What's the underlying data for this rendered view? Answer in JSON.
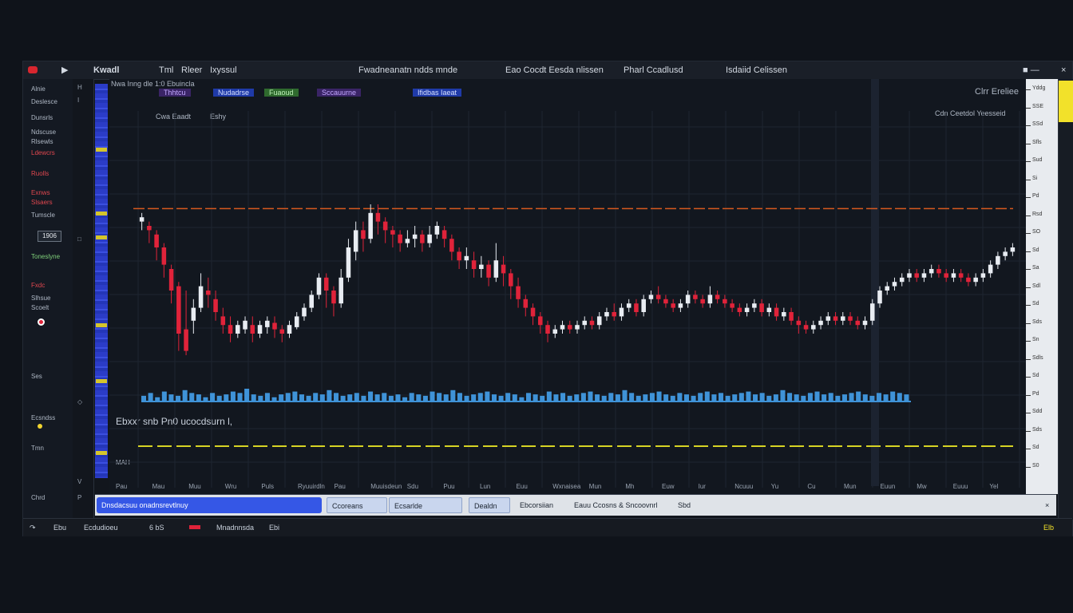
{
  "titlebar": {
    "app_name": "Kwadl",
    "menu": [
      "Tml",
      "Rleer",
      "Ixyssul"
    ],
    "center_text": "Fwadneanatn ndds mnde",
    "title": "Eao Cocdt Eesda nlissen",
    "panel_a": "Pharl Ccadlusd",
    "panel_b": "Isdaiid Celissen"
  },
  "chart_header": {
    "row1_text": "Nwa Inng dle 1:0 Ebuincla",
    "row2_pills": [
      "Thhtcu",
      "Nudadrse",
      "Fuaoud",
      "Sccauurne",
      "Ifidbas Iaeat"
    ],
    "symbol_line": "Cwa Eaadt",
    "symbol_value": "Eshy",
    "right_title": "Clrr Ereliee",
    "right_sub": "Cdn Ceetdol Yeesseid"
  },
  "left_panel": {
    "items": [
      "Alnie",
      "Deslesce",
      "Dunsrls",
      "Ndscuse",
      "Rlsewls",
      "Ldewcrs",
      "Ruolls",
      "Exnws",
      "Slsaers",
      "Tumscle",
      "Toneslyne"
    ],
    "value_box": "1906",
    "lower_items": [
      "Fxdc",
      "Slhsue",
      "Scoelt",
      "Ses",
      "Ecsndss",
      "Tmn"
    ],
    "status_bottom": "Chrd"
  },
  "tools": [
    "H",
    "I",
    "□",
    "◇",
    "V",
    "P"
  ],
  "indicator_label": "Ebxxr snb Pn0 ucocdsurn l,",
  "mini_label": "MAH",
  "chart_data": {
    "type": "candlestick",
    "title": "",
    "xlabel": "",
    "ylabel": "",
    "ylim": [
      0,
      100
    ],
    "reference_line": 88,
    "candles": [
      [
        82,
        84,
        86,
        78
      ],
      [
        80,
        78,
        82,
        72
      ],
      [
        76,
        70,
        78,
        64
      ],
      [
        70,
        62,
        72,
        56
      ],
      [
        60,
        50,
        62,
        44
      ],
      [
        52,
        30,
        54,
        22
      ],
      [
        32,
        22,
        50,
        20
      ],
      [
        36,
        42,
        46,
        30
      ],
      [
        42,
        52,
        58,
        40
      ],
      [
        50,
        48,
        56,
        42
      ],
      [
        46,
        40,
        50,
        36
      ],
      [
        38,
        34,
        42,
        30
      ],
      [
        34,
        30,
        38,
        26
      ],
      [
        30,
        34,
        36,
        28
      ],
      [
        32,
        36,
        38,
        30
      ],
      [
        34,
        30,
        38,
        26
      ],
      [
        30,
        34,
        36,
        28
      ],
      [
        33,
        36,
        38,
        30
      ],
      [
        35,
        32,
        38,
        28
      ],
      [
        32,
        30,
        34,
        26
      ],
      [
        30,
        34,
        36,
        28
      ],
      [
        33,
        38,
        40,
        32
      ],
      [
        38,
        42,
        44,
        36
      ],
      [
        42,
        48,
        50,
        40
      ],
      [
        48,
        56,
        58,
        46
      ],
      [
        56,
        50,
        58,
        42
      ],
      [
        50,
        44,
        52,
        38
      ],
      [
        44,
        56,
        60,
        42
      ],
      [
        56,
        70,
        74,
        54
      ],
      [
        68,
        78,
        82,
        64
      ],
      [
        78,
        74,
        82,
        68
      ],
      [
        74,
        86,
        90,
        72
      ],
      [
        86,
        82,
        90,
        76
      ],
      [
        82,
        78,
        84,
        72
      ],
      [
        78,
        76,
        80,
        70
      ],
      [
        76,
        72,
        78,
        68
      ],
      [
        72,
        74,
        78,
        70
      ],
      [
        74,
        76,
        80,
        70
      ],
      [
        76,
        72,
        78,
        68
      ],
      [
        72,
        76,
        80,
        70
      ],
      [
        76,
        80,
        82,
        74
      ],
      [
        78,
        74,
        80,
        70
      ],
      [
        74,
        68,
        76,
        64
      ],
      [
        68,
        64,
        70,
        60
      ],
      [
        64,
        66,
        70,
        60
      ],
      [
        64,
        60,
        68,
        56
      ],
      [
        60,
        62,
        66,
        56
      ],
      [
        62,
        56,
        64,
        52
      ],
      [
        56,
        64,
        72,
        54
      ],
      [
        62,
        58,
        66,
        52
      ],
      [
        58,
        52,
        60,
        46
      ],
      [
        52,
        46,
        56,
        42
      ],
      [
        46,
        42,
        48,
        38
      ],
      [
        42,
        38,
        44,
        34
      ],
      [
        38,
        34,
        40,
        30
      ],
      [
        34,
        30,
        36,
        26
      ],
      [
        30,
        32,
        34,
        28
      ],
      [
        32,
        34,
        36,
        30
      ],
      [
        34,
        32,
        36,
        30
      ],
      [
        32,
        34,
        36,
        30
      ],
      [
        34,
        36,
        38,
        32
      ],
      [
        36,
        34,
        38,
        32
      ],
      [
        34,
        38,
        40,
        32
      ],
      [
        38,
        40,
        42,
        36
      ],
      [
        40,
        38,
        44,
        36
      ],
      [
        38,
        42,
        44,
        36
      ],
      [
        42,
        44,
        46,
        40
      ],
      [
        44,
        40,
        46,
        38
      ],
      [
        40,
        46,
        48,
        38
      ],
      [
        46,
        48,
        50,
        44
      ],
      [
        48,
        46,
        52,
        44
      ],
      [
        46,
        44,
        48,
        42
      ],
      [
        44,
        42,
        46,
        40
      ],
      [
        42,
        44,
        46,
        40
      ],
      [
        44,
        48,
        50,
        42
      ],
      [
        48,
        46,
        50,
        44
      ],
      [
        46,
        44,
        48,
        42
      ],
      [
        44,
        48,
        52,
        42
      ],
      [
        48,
        46,
        50,
        44
      ],
      [
        46,
        44,
        48,
        42
      ],
      [
        44,
        42,
        46,
        40
      ],
      [
        42,
        40,
        44,
        38
      ],
      [
        40,
        42,
        44,
        38
      ],
      [
        42,
        44,
        46,
        40
      ],
      [
        44,
        40,
        46,
        38
      ],
      [
        40,
        42,
        44,
        38
      ],
      [
        42,
        38,
        44,
        36
      ],
      [
        38,
        40,
        42,
        36
      ],
      [
        40,
        36,
        42,
        34
      ],
      [
        36,
        34,
        38,
        30
      ],
      [
        34,
        32,
        36,
        30
      ],
      [
        32,
        34,
        36,
        30
      ],
      [
        34,
        36,
        38,
        32
      ],
      [
        36,
        38,
        40,
        34
      ],
      [
        38,
        36,
        40,
        34
      ],
      [
        36,
        38,
        40,
        34
      ],
      [
        38,
        36,
        40,
        34
      ],
      [
        36,
        34,
        38,
        32
      ],
      [
        34,
        36,
        38,
        32
      ],
      [
        36,
        44,
        46,
        34
      ],
      [
        44,
        50,
        52,
        42
      ],
      [
        50,
        52,
        54,
        48
      ],
      [
        52,
        54,
        56,
        50
      ],
      [
        54,
        56,
        58,
        52
      ],
      [
        56,
        58,
        60,
        54
      ],
      [
        58,
        56,
        60,
        54
      ],
      [
        56,
        58,
        60,
        54
      ],
      [
        58,
        60,
        62,
        56
      ],
      [
        60,
        58,
        62,
        56
      ],
      [
        58,
        56,
        60,
        54
      ],
      [
        56,
        58,
        60,
        54
      ],
      [
        58,
        56,
        60,
        54
      ],
      [
        56,
        54,
        58,
        52
      ],
      [
        54,
        56,
        58,
        52
      ],
      [
        56,
        58,
        60,
        54
      ],
      [
        58,
        62,
        64,
        56
      ],
      [
        62,
        66,
        68,
        60
      ],
      [
        66,
        68,
        70,
        64
      ],
      [
        68,
        70,
        72,
        66
      ]
    ],
    "volume": [
      4,
      6,
      3,
      7,
      5,
      4,
      8,
      6,
      5,
      3,
      6,
      4,
      5,
      7,
      6,
      9,
      5,
      4,
      6,
      3,
      5,
      6,
      7,
      5,
      4,
      6,
      5,
      8,
      6,
      4,
      5,
      6,
      4,
      7,
      5,
      6,
      4,
      5,
      3,
      6,
      5,
      4,
      7,
      6,
      5,
      8,
      6,
      4,
      5,
      6,
      7,
      5,
      4,
      6,
      5,
      3,
      6,
      5,
      4,
      7,
      5,
      6,
      4,
      5,
      6,
      7,
      5,
      4,
      6,
      5,
      8,
      6,
      4,
      5,
      6,
      7,
      5,
      4,
      6,
      5,
      4,
      6,
      7,
      5,
      6,
      4,
      5,
      6,
      7,
      5,
      6,
      4,
      5,
      8,
      6,
      5,
      4,
      6,
      7,
      5,
      6,
      4,
      5,
      6,
      7,
      5,
      4,
      6,
      5,
      7,
      6,
      5
    ],
    "price_labels": [
      "Yddg",
      "SSE",
      "SSd",
      "Sfls",
      "Sud",
      "Si",
      "Pd",
      "Rsd",
      "SO",
      "Sd",
      "Sa",
      "Sdl",
      "Sd",
      "Sds",
      "Sn",
      "Sdls",
      "Sd",
      "Pd",
      "Sdd",
      "Sds",
      "Sd",
      "S0"
    ],
    "time_labels": [
      "Pau",
      "Mau",
      "Muu",
      "Wru",
      "Puls",
      "Ryuuirdln",
      "Pau",
      "Muuisdeun",
      "Sdu",
      "Puu",
      "Lun",
      "Euu",
      "Wxnaisea",
      "Mun",
      "Mh",
      "Euw",
      "Iur",
      "Ncuuu",
      "Yu",
      "Cu",
      "Mun",
      "Euun",
      "Mw",
      "Euuu",
      "Yel"
    ]
  },
  "tabs": [
    {
      "label": "Dnsdacsuu onadnsrevtlnuy",
      "active": true
    },
    {
      "label": "Ccoreans"
    },
    {
      "label": "Ecsarlde"
    },
    {
      "label": "Dealdn"
    },
    {
      "label": "Ebcorsiian"
    },
    {
      "label": "Eauu Ccosns & Sncoovnrl"
    },
    {
      "label": "Sbd"
    }
  ],
  "statusbar": {
    "items": [
      "Ebu",
      "Ecdudioeu",
      "6 bS",
      "Mnadnnsda",
      "Ebi"
    ],
    "right": "Elb"
  },
  "colors": {
    "up": "#e8ecf2",
    "down": "#e0233a",
    "reference_line": "#d8591f",
    "volume": "#3f93d8",
    "indicator_line": "#d7d424",
    "accent": "#3557e6"
  }
}
